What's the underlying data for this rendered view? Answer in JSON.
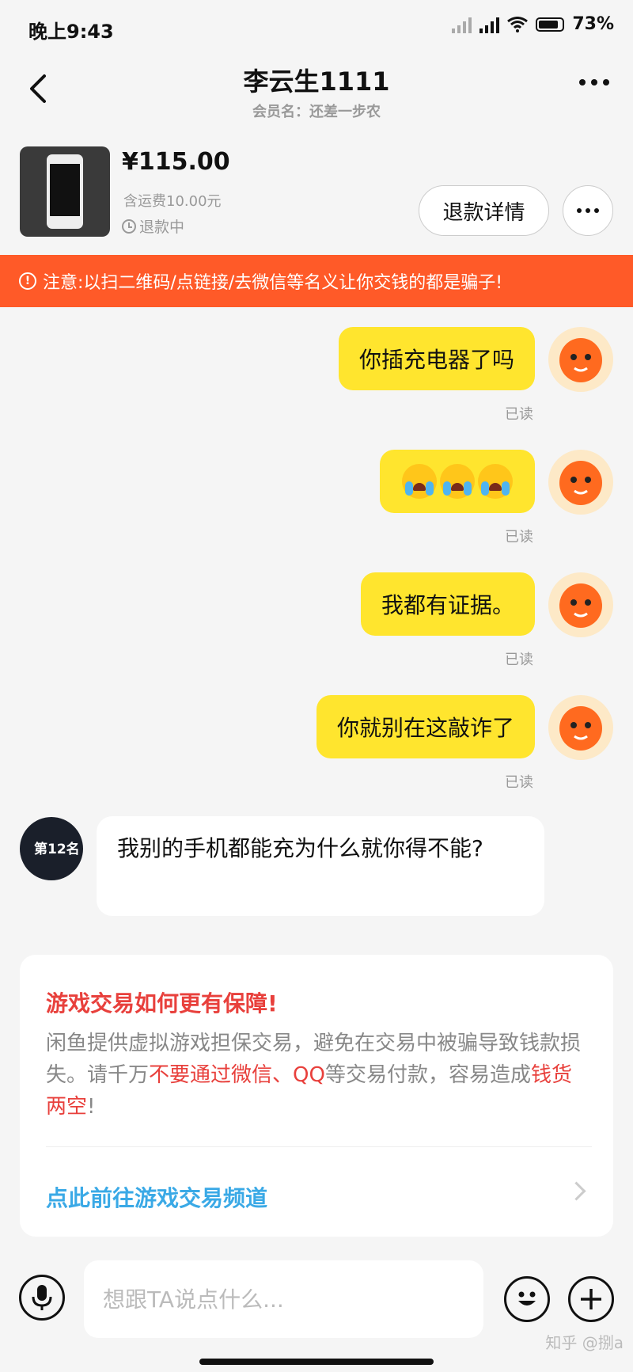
{
  "status_bar": {
    "time": "晚上9:43",
    "battery": "73%"
  },
  "header": {
    "title": "李云生1111",
    "subtitle": "会员名：还差一步农"
  },
  "product": {
    "price": "¥115.00",
    "shipping": "含运费10.00元",
    "status": "退款中",
    "refund_button": "退款详情"
  },
  "warning": {
    "text": "注意:以扫二维码/点链接/去微信等名义让你交钱的都是骗子!"
  },
  "messages": [
    {
      "from": "me",
      "text": "你插充电器了吗",
      "read": "已读"
    },
    {
      "from": "me",
      "text": "",
      "emoji": [
        "crying-emoji",
        "crying-emoji",
        "crying-emoji"
      ],
      "read": "已读"
    },
    {
      "from": "me",
      "text": "我都有证据。",
      "read": "已读"
    },
    {
      "from": "me",
      "text": "你就别在这敲诈了",
      "read": "已读"
    },
    {
      "from": "other",
      "text": "我别的手机都能充为什么就你得不能?",
      "avatar_text": "第12名"
    }
  ],
  "game_card": {
    "title": "游戏交易如何更有保障!",
    "body_1": "闲鱼提供虚拟游戏担保交易，避免在交易中被骗导致钱款损失。请千万",
    "body_red_1": "不要通过微信、QQ",
    "body_2": "等交易付款，容易造成",
    "body_red_2": "钱货两空",
    "body_3": "!",
    "link": "点此前往游戏交易频道"
  },
  "input": {
    "placeholder": "想跟TA说点什么..."
  },
  "watermark": "知乎 @捌a",
  "colors": {
    "bubble_me": "#ffe52e",
    "warning_bg": "#ff5a28",
    "link": "#3aa9e6",
    "alert_red": "#e8403c"
  }
}
